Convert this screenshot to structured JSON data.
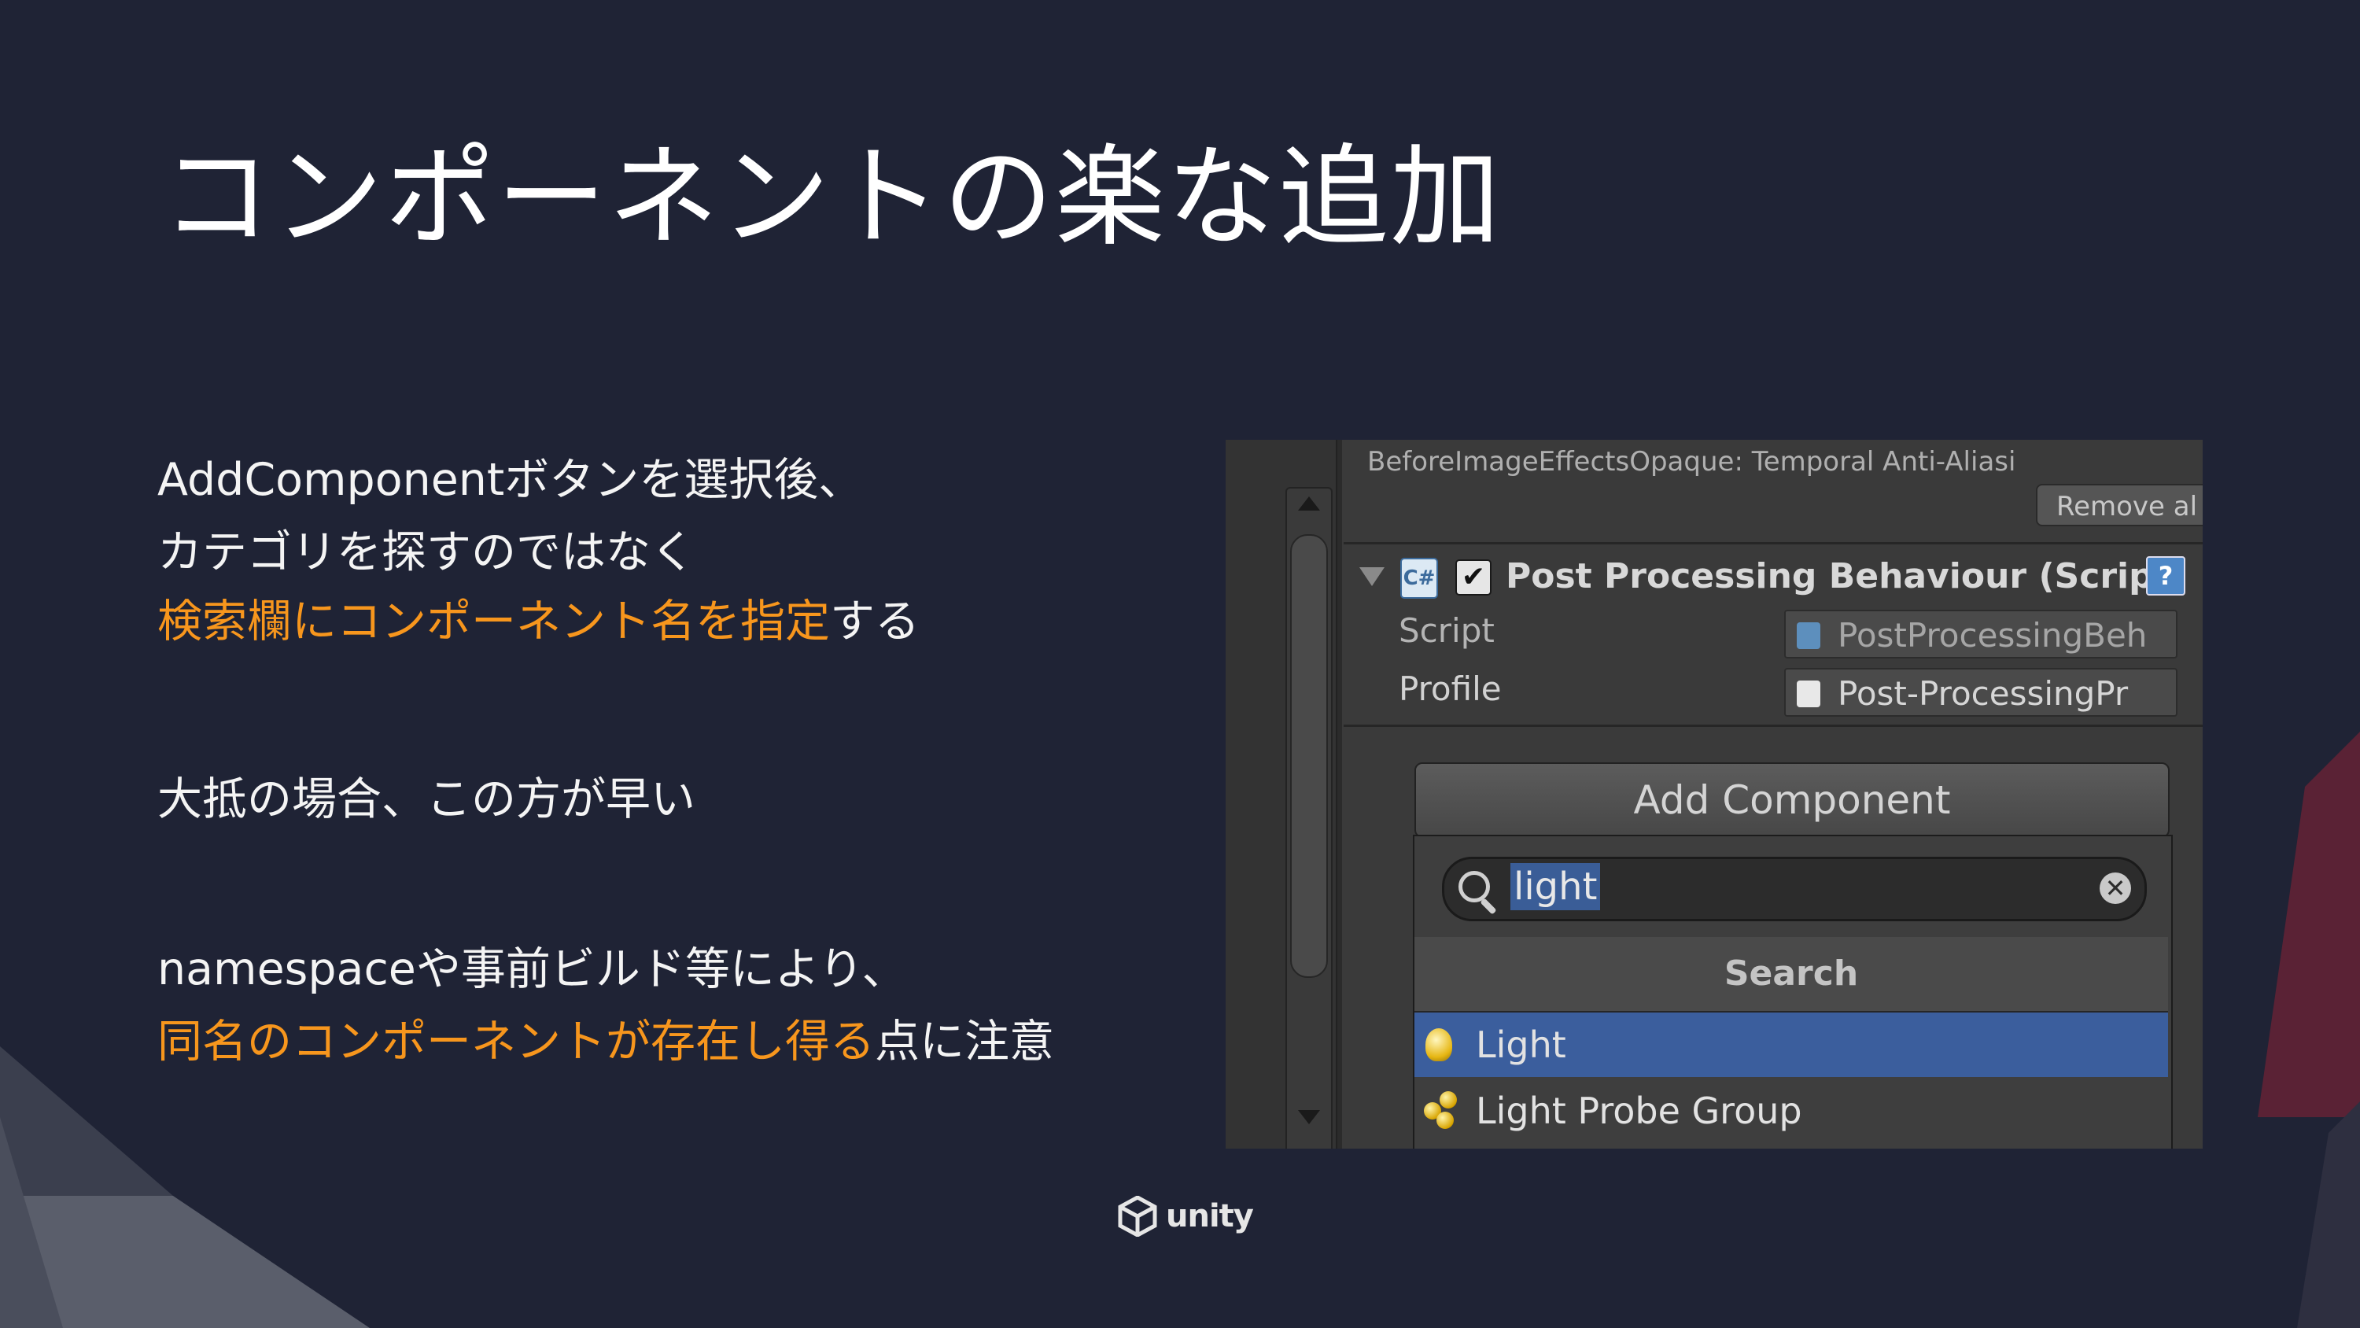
{
  "slide": {
    "title": "コンポーネントの楽な追加",
    "paragraph1": {
      "line1": "AddComponentボタンを選択後、",
      "line2": "カテゴリを探すのではなく",
      "line3_highlight": "検索欄にコンポーネント名を指定",
      "line3_rest": "する"
    },
    "paragraph2": {
      "line1": "大抵の場合、この方が早い"
    },
    "paragraph3": {
      "line1": "namespaceや事前ビルド等により、",
      "line2_highlight": "同名のコンポーネントが存在し得る",
      "line2_rest": "点に注意"
    },
    "colors": {
      "background": "#1f2335",
      "highlight": "#f7961d",
      "text": "#ffffff"
    }
  },
  "inspector": {
    "top_line": "BeforeImageEffectsOpaque: Temporal Anti-Aliasi",
    "remove_button": "Remove al",
    "component_title": "Post Processing Behaviour (Script",
    "cs_icon_label": "C#",
    "checkbox_mark": "✔",
    "help_icon_label": "?",
    "fields": [
      {
        "label": "Script",
        "value": "PostProcessingBeh"
      },
      {
        "label": "Profile",
        "value": "Post-ProcessingPr"
      }
    ],
    "add_component_button": "Add Component",
    "search_value": "light",
    "clear_icon_glyph": "✕",
    "list_header": "Search",
    "results": [
      {
        "label": "Light",
        "selected": true,
        "icon": "light-bulb-icon"
      },
      {
        "label": "Light Probe Group",
        "selected": false,
        "icon": "light-probe-group-icon"
      }
    ]
  },
  "logo": {
    "word": "unity"
  }
}
